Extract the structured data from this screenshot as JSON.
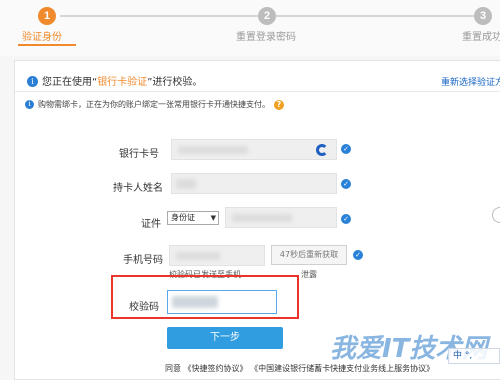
{
  "steps": [
    {
      "number": "1",
      "label": "验证身份",
      "state": "active"
    },
    {
      "number": "2",
      "label": "重置登录密码",
      "state": "todo"
    },
    {
      "number": "3",
      "label": "重置成功",
      "state": "todo"
    }
  ],
  "notice": {
    "prefix": "您正在使用“",
    "method": "银行卡验证",
    "suffix": "”进行校验。",
    "reselect_link": "重新选择验证方"
  },
  "hint": "购物需绑卡，正在为你的账户绑定一张常用银行卡开通快捷支付。",
  "form": {
    "card_number_label": "银行卡号",
    "holder_name_label": "持卡人姓名",
    "id_label": "证件",
    "id_type_selected": "身份证",
    "phone_label": "手机号码",
    "resend_button": "47秒后重新获取",
    "code_sent_text": "校验码已发送至手机",
    "code_sent_tail": "泄露",
    "code_label": "校验码",
    "next_button": "下一步",
    "agreement_prefix": "同意",
    "agreement_link1": "《快捷签约协议》",
    "agreement_link2": "《中国建设银行储蓄卡快捷支付业务线上服务协议》"
  },
  "overlay": {
    "watermark": "我爱IT技术网",
    "ime": "中 °,"
  },
  "colors": {
    "accent": "#f08a2c",
    "link": "#1a66c4",
    "primary_button": "#2f9de0",
    "check": "#2a82d8",
    "highlight": "#e8362a"
  }
}
